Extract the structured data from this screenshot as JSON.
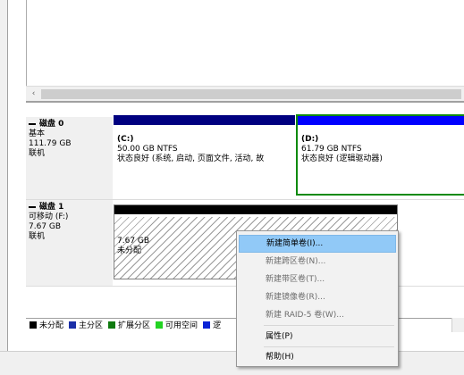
{
  "scrollbar": {
    "left_arrow": "‹"
  },
  "disks": [
    {
      "name": "磁盘 0",
      "type": "基本",
      "size": "111.79 GB",
      "status": "联机",
      "partitions": [
        {
          "label": "(C:)",
          "size_fs": "50.00 GB NTFS",
          "status": "状态良好 (系统, 启动, 页面文件, 活动, 故"
        },
        {
          "label": "(D:)",
          "size_fs": "61.79 GB NTFS",
          "status": "状态良好 (逻辑驱动器)"
        }
      ]
    },
    {
      "name": "磁盘 1",
      "type": "可移动 (F:)",
      "size": "7.67 GB",
      "status": "联机",
      "partitions": [
        {
          "size": "7.67 GB",
          "status": "未分配"
        }
      ]
    }
  ],
  "legend": [
    {
      "label": "未分配",
      "color": "#000000"
    },
    {
      "label": "主分区",
      "color": "#1b2fa8"
    },
    {
      "label": "扩展分区",
      "color": "#0f7a0f"
    },
    {
      "label": "可用空间",
      "color": "#23d323"
    },
    {
      "label": "逻",
      "color": "#0a23d6"
    }
  ],
  "context_menu": {
    "items": [
      {
        "label": "新建简单卷(I)...",
        "enabled": true,
        "highlighted": true
      },
      {
        "label": "新建跨区卷(N)...",
        "enabled": false
      },
      {
        "label": "新建带区卷(T)...",
        "enabled": false
      },
      {
        "label": "新建镜像卷(R)...",
        "enabled": false
      },
      {
        "label": "新建 RAID-5 卷(W)...",
        "enabled": false
      },
      {
        "label": "属性(P)",
        "enabled": true
      },
      {
        "label": "帮助(H)",
        "enabled": true
      }
    ]
  },
  "colors": {
    "primary_partition": "#000080",
    "logical_drive": "#0000ff",
    "unallocated": "#000000",
    "selection_border": "#0e8a0e",
    "menu_highlight": "#91c9f7"
  }
}
